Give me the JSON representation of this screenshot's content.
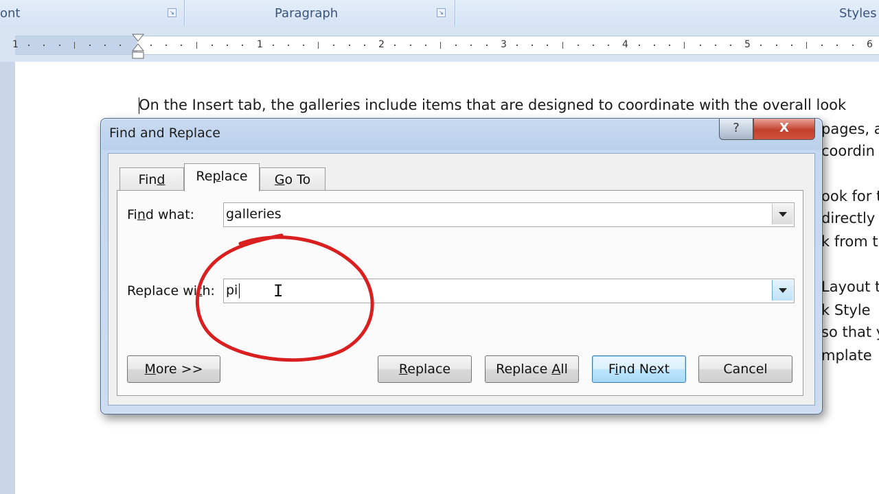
{
  "ribbon": {
    "groups": [
      {
        "label": "ont"
      },
      {
        "label": "Paragraph"
      },
      {
        "label": "Styles"
      }
    ]
  },
  "ruler": {
    "numbers": [
      "1",
      "1",
      "2",
      "3",
      "4",
      "5",
      "6"
    ]
  },
  "document": {
    "lines": [
      "On the Insert tab, the galleries include items that are designed to coordinate with the overall look",
      "pages, a",
      "coordin",
      "ook for t",
      "directly",
      "k from t",
      "Layout t",
      "k Style",
      "so that y",
      "mplate"
    ]
  },
  "dialog": {
    "title": "Find and Replace",
    "help_label": "?",
    "close_label": "X",
    "tabs": [
      {
        "label": "Find",
        "active": false
      },
      {
        "label": "Replace",
        "active": true
      },
      {
        "label": "Go To",
        "active": false
      }
    ],
    "find_what": {
      "label": "Find what:",
      "value": "galleries"
    },
    "replace_with": {
      "label": "Replace with:",
      "value": "pi"
    },
    "buttons": {
      "more": "More >>",
      "replace": "Replace",
      "replace_all": "Replace All",
      "find_next": "Find Next",
      "cancel": "Cancel"
    }
  },
  "colors": {
    "annotation": "#d91f1f",
    "close_button": "#c2402c",
    "focus_button": "#3c7fb1"
  }
}
